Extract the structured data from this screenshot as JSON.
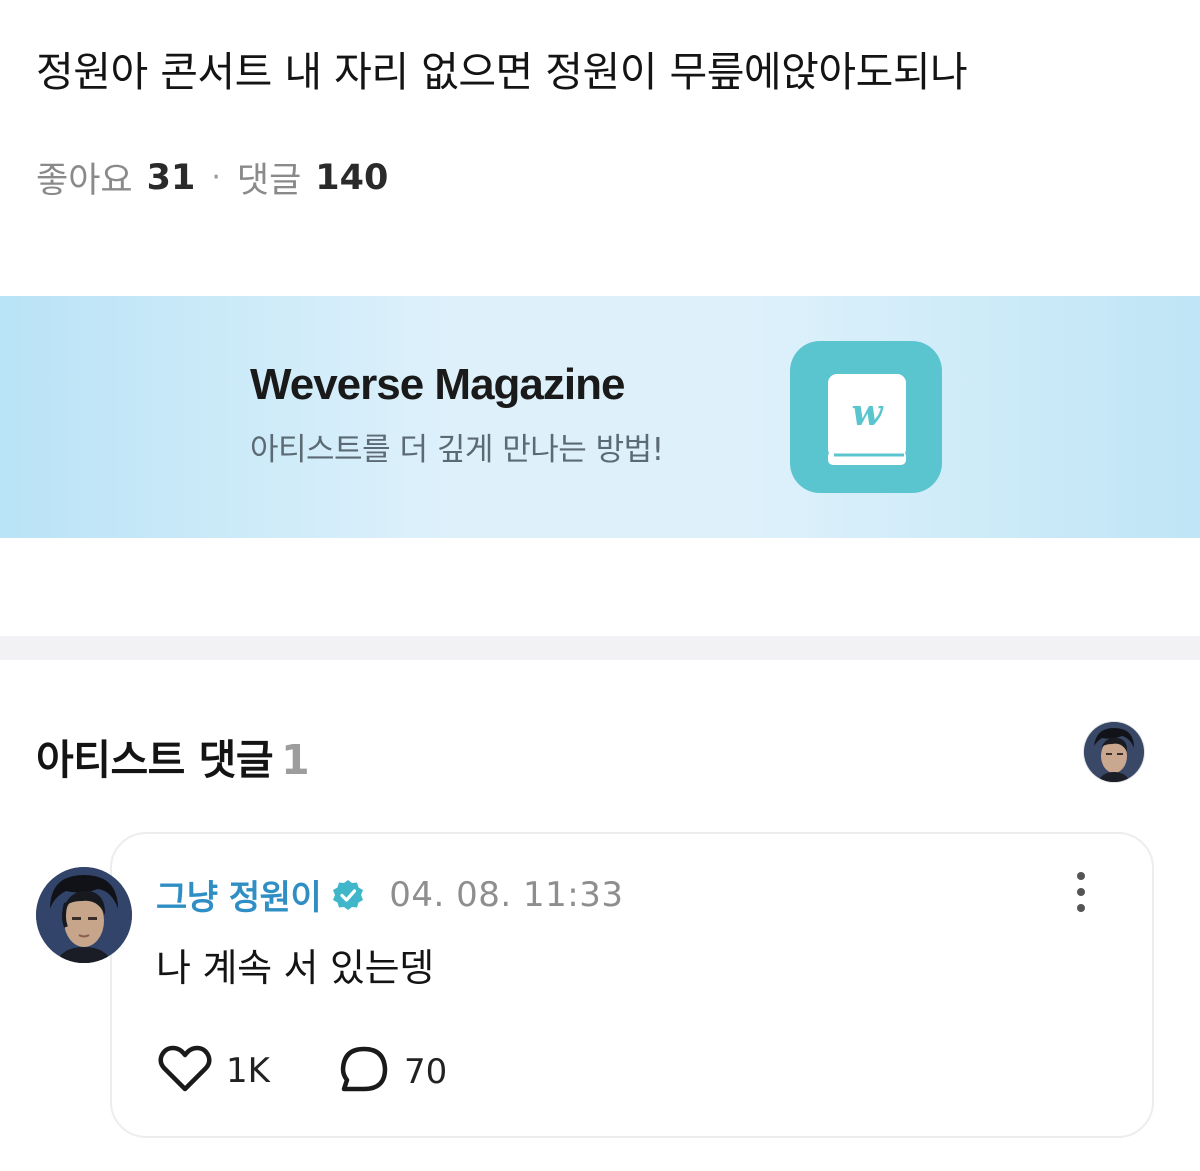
{
  "post": {
    "title": "정원아 콘서트 내 자리 없으면 정원이 무릎에앉아도되나",
    "likes_label": "좋아요",
    "likes_count": "31",
    "separator": "·",
    "comments_label": "댓글",
    "comments_count": "140"
  },
  "banner": {
    "title": "Weverse Magazine",
    "subtitle": "아티스트를 더 깊게 만나는 방법!",
    "icon": "weverse-magazine-book-icon",
    "icon_letter": "w",
    "background_color": "#d9effa",
    "icon_color": "#5bc5cf"
  },
  "artist_comments": {
    "title": "아티스트 댓글",
    "count": "1"
  },
  "comment": {
    "author": "그냥 정원이",
    "verified_icon": "verified-badge-icon",
    "timestamp": "04. 08. 11:33",
    "body": "나 계속 서 있는뎅",
    "like_count": "1K",
    "reply_count": "70",
    "author_color": "#2f8fc4"
  }
}
